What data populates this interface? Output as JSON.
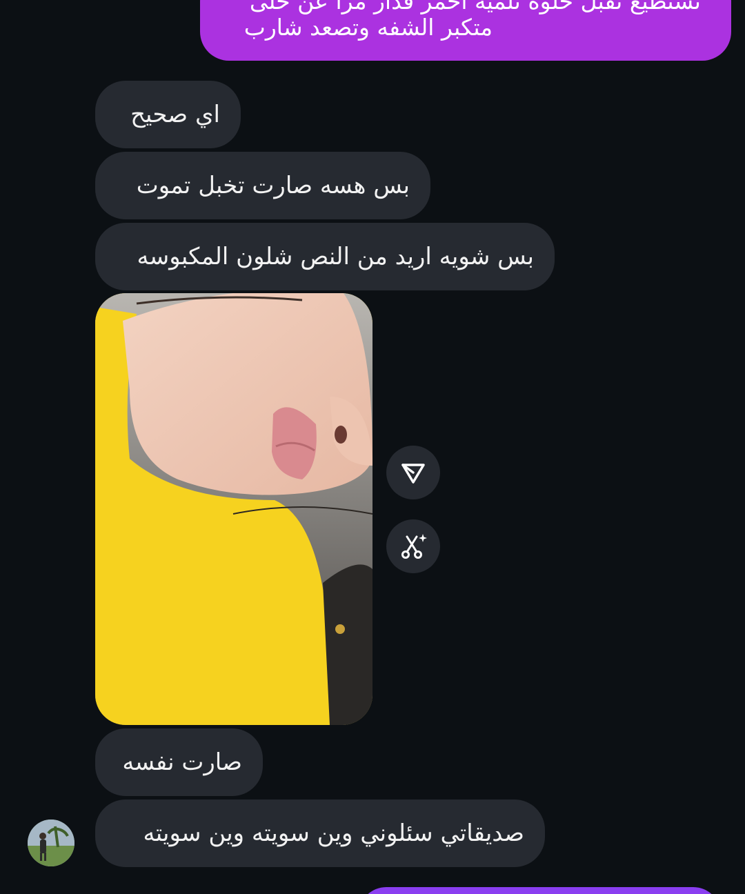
{
  "colors": {
    "background": "#0c1014",
    "sent_bubble": "#ab32e0",
    "received_bubble": "#262a31",
    "text": "#f2f2f2"
  },
  "conversation": {
    "sent_message": {
      "line_partial": "تستطيع تقبل خلوه نلميه احمر قدار مرا عن حلى",
      "line_2": "متكبر الشفه وتصعد شارب"
    },
    "received_messages": [
      {
        "text": "اي صحيح"
      },
      {
        "text": "بس هسه صارت تخبل تموت"
      },
      {
        "text": "بس شويه اريد من النص شلون المكبوسه"
      },
      {
        "text": "صارت نفسه"
      },
      {
        "text": "صديقاتي سئلوني وين سويته وين سويته"
      }
    ],
    "photo_message": {
      "icon": "photo-image",
      "actions": [
        {
          "name": "share",
          "icon": "send-icon"
        },
        {
          "name": "edit",
          "icon": "sparkle-scissors-icon"
        }
      ]
    },
    "sender_avatar": {
      "icon": "avatar-photo"
    }
  }
}
